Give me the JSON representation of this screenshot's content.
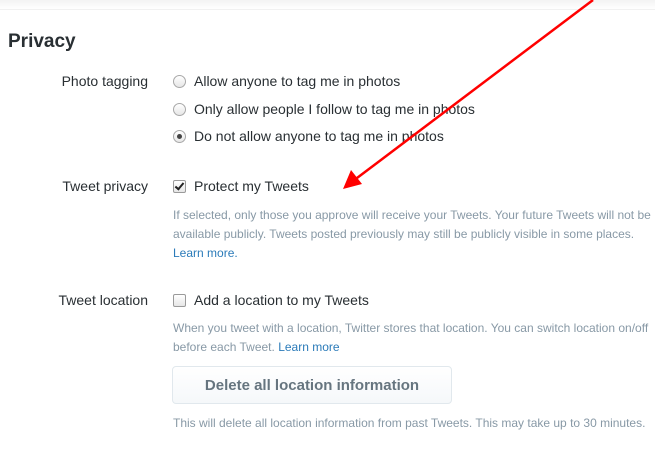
{
  "section": {
    "title": "Privacy"
  },
  "photo_tagging": {
    "label": "Photo tagging",
    "options": [
      {
        "label": "Allow anyone to tag me in photos",
        "selected": false
      },
      {
        "label": "Only allow people I follow to tag me in photos",
        "selected": false
      },
      {
        "label": "Do not allow anyone to tag me in photos",
        "selected": true
      }
    ]
  },
  "tweet_privacy": {
    "label": "Tweet privacy",
    "checkbox_label": "Protect my Tweets",
    "checked": true,
    "help": "If selected, only those you approve will receive your Tweets. Your future Tweets will not be available publicly. Tweets posted previously may still be publicly visible in some places.",
    "learn_more": "Learn more."
  },
  "tweet_location": {
    "label": "Tweet location",
    "checkbox_label": "Add a location to my Tweets",
    "checked": false,
    "help": "When you tweet with a location, Twitter stores that location. You can switch location on/off before each Tweet.",
    "learn_more": "Learn more",
    "delete_button": "Delete all location information",
    "delete_help": "This will delete all location information from past Tweets. This may take up to 30 minutes."
  },
  "annotation": {
    "arrow_color": "#ff0000"
  }
}
